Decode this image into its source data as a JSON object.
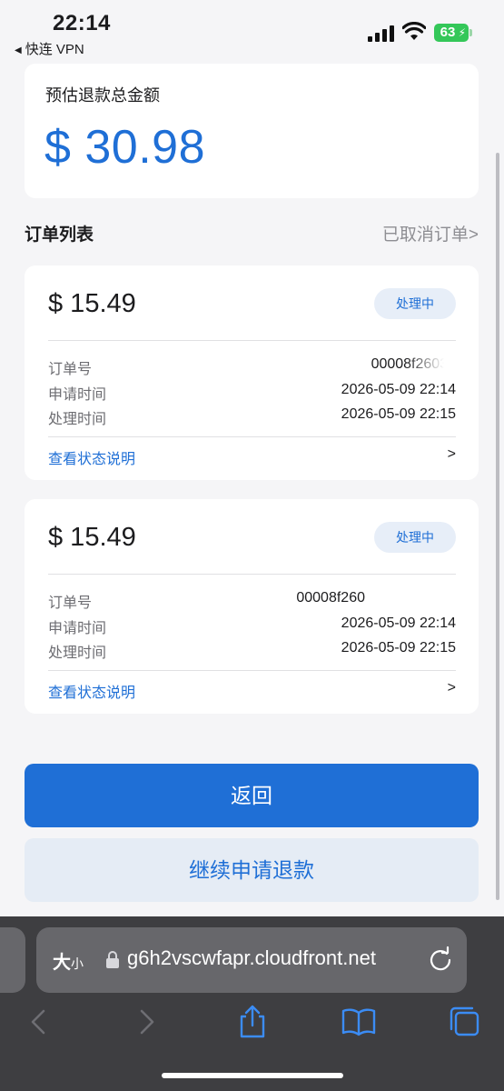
{
  "status_bar": {
    "time": "22:14",
    "back_app": "快连 VPN",
    "battery": "63"
  },
  "summary": {
    "label": "预估退款总金额",
    "amount": "$ 30.98"
  },
  "order_list": {
    "title": "订单列表",
    "cancelled_link": "已取消订单>"
  },
  "orders": [
    {
      "amount": "$ 15.49",
      "status": "处理中",
      "order_no_label": "订单号",
      "order_no": "00008f26035",
      "apply_time_label": "申请时间",
      "apply_time": "2026-05-09 22:14",
      "process_time_label": "处理时间",
      "process_time": "2026-05-09 22:15",
      "status_help": "查看状态说明",
      "chevron": ">"
    },
    {
      "amount": "$ 15.49",
      "status": "处理中",
      "order_no_label": "订单号",
      "order_no": "00008f260",
      "apply_time_label": "申请时间",
      "apply_time": "2026-05-09 22:14",
      "process_time_label": "处理时间",
      "process_time": "2026-05-09 22:15",
      "status_help": "查看状态说明",
      "chevron": ">"
    }
  ],
  "buttons": {
    "back": "返回",
    "continue": "继续申请退款"
  },
  "browser": {
    "aa_big": "大",
    "aa_small": "小",
    "url": "g6h2vscwfapr.cloudfront.net"
  },
  "colors": {
    "accent": "#1f6fd6",
    "background": "#f5f5f7",
    "badge_bg": "#e7eef8",
    "toolbar": "#3e3e41"
  }
}
